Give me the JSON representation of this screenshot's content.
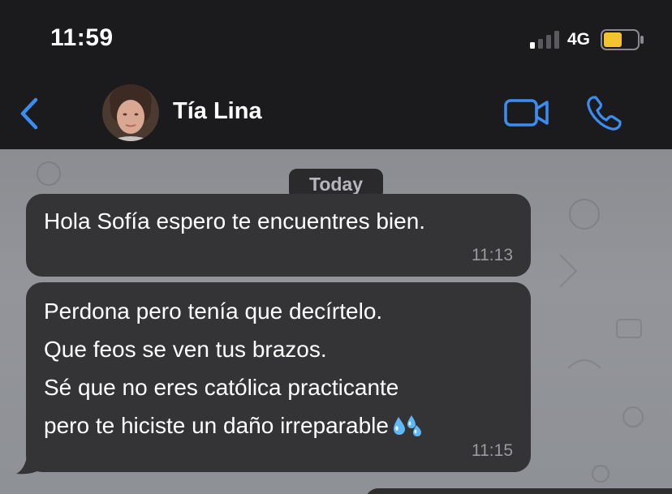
{
  "status_bar": {
    "time": "11:59",
    "network": "4G",
    "battery_level": 0.55,
    "battery_color": "#f4c430",
    "signal_bars_active": 1,
    "signal_bars_total": 4
  },
  "header": {
    "back_icon": "chevron-left-icon",
    "contact_name": "Tía Lina",
    "video_icon": "video-camera-icon",
    "phone_icon": "phone-icon",
    "accent_color": "#3b8ef0"
  },
  "chat": {
    "date_label": "Today",
    "messages": [
      {
        "text": "Hola Sofía espero te encuentres bien.",
        "time": "11:13"
      },
      {
        "lines": [
          "Perdona pero tenía que decírtelo.",
          "Que feos se ven tus brazos.",
          "Sé que no eres católica practicante",
          "pero te hiciste un daño irreparable"
        ],
        "emoji": "sweat-droplets-icon",
        "time": "11:15"
      }
    ]
  }
}
